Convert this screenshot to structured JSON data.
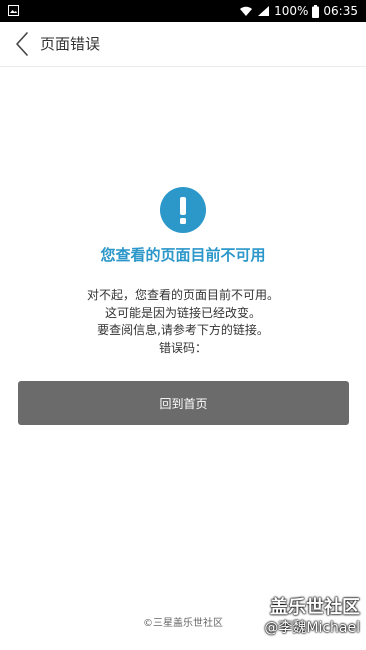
{
  "status_bar": {
    "battery_percent": "100%",
    "time": "06:35"
  },
  "app_bar": {
    "title": "页面错误"
  },
  "main": {
    "heading": "您查看的页面目前不可用",
    "body_lines": [
      "对不起，您查看的页面目前不可用。",
      "这可能是因为链接已经改变。",
      "要查阅信息,请参考下方的链接。",
      "错误码："
    ],
    "home_button_label": "回到首页"
  },
  "footer": {
    "copyright": "©三星盖乐世社区"
  },
  "watermark": {
    "line1": "盖乐世社区",
    "line2": "@李魏Michael"
  },
  "colors": {
    "accent": "#2c97c9",
    "button_bg": "#6b6b6b"
  }
}
